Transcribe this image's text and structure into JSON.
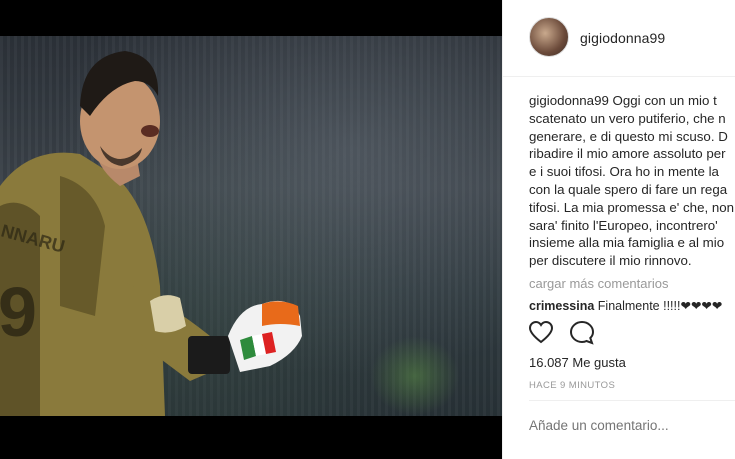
{
  "post": {
    "username": "gigiodonna99",
    "caption_user": "gigiodonna99",
    "caption_lines": [
      " Oggi con un mio t",
      "scatenato un vero putiferio, che n",
      "generare, e di questo mi scuso. D",
      "ribadire il mio amore assoluto per",
      "e i suoi tifosi. Ora ho in mente la",
      "con la quale spero di fare un rega",
      "tifosi. La mia promessa e' che, non",
      "sara' finito l'Europeo, incontrero'",
      "insieme alla mia famiglia e al mio",
      "per discutere il mio rinnovo."
    ],
    "load_more": "cargar más comentarios",
    "comment_user": "crimessina",
    "comment_text": " Finalmente !!!!!❤❤❤❤",
    "likes": "16.087 Me gusta",
    "timestamp": "HACE 9 MINUTOS",
    "comment_placeholder": "Añade un comentario..."
  },
  "icons": {
    "like": "heart-icon",
    "comment": "comment-bubble-icon"
  },
  "colors": {
    "text": "#262626",
    "muted": "#999999",
    "border": "#efefef",
    "jersey": "#8a7a3c"
  }
}
